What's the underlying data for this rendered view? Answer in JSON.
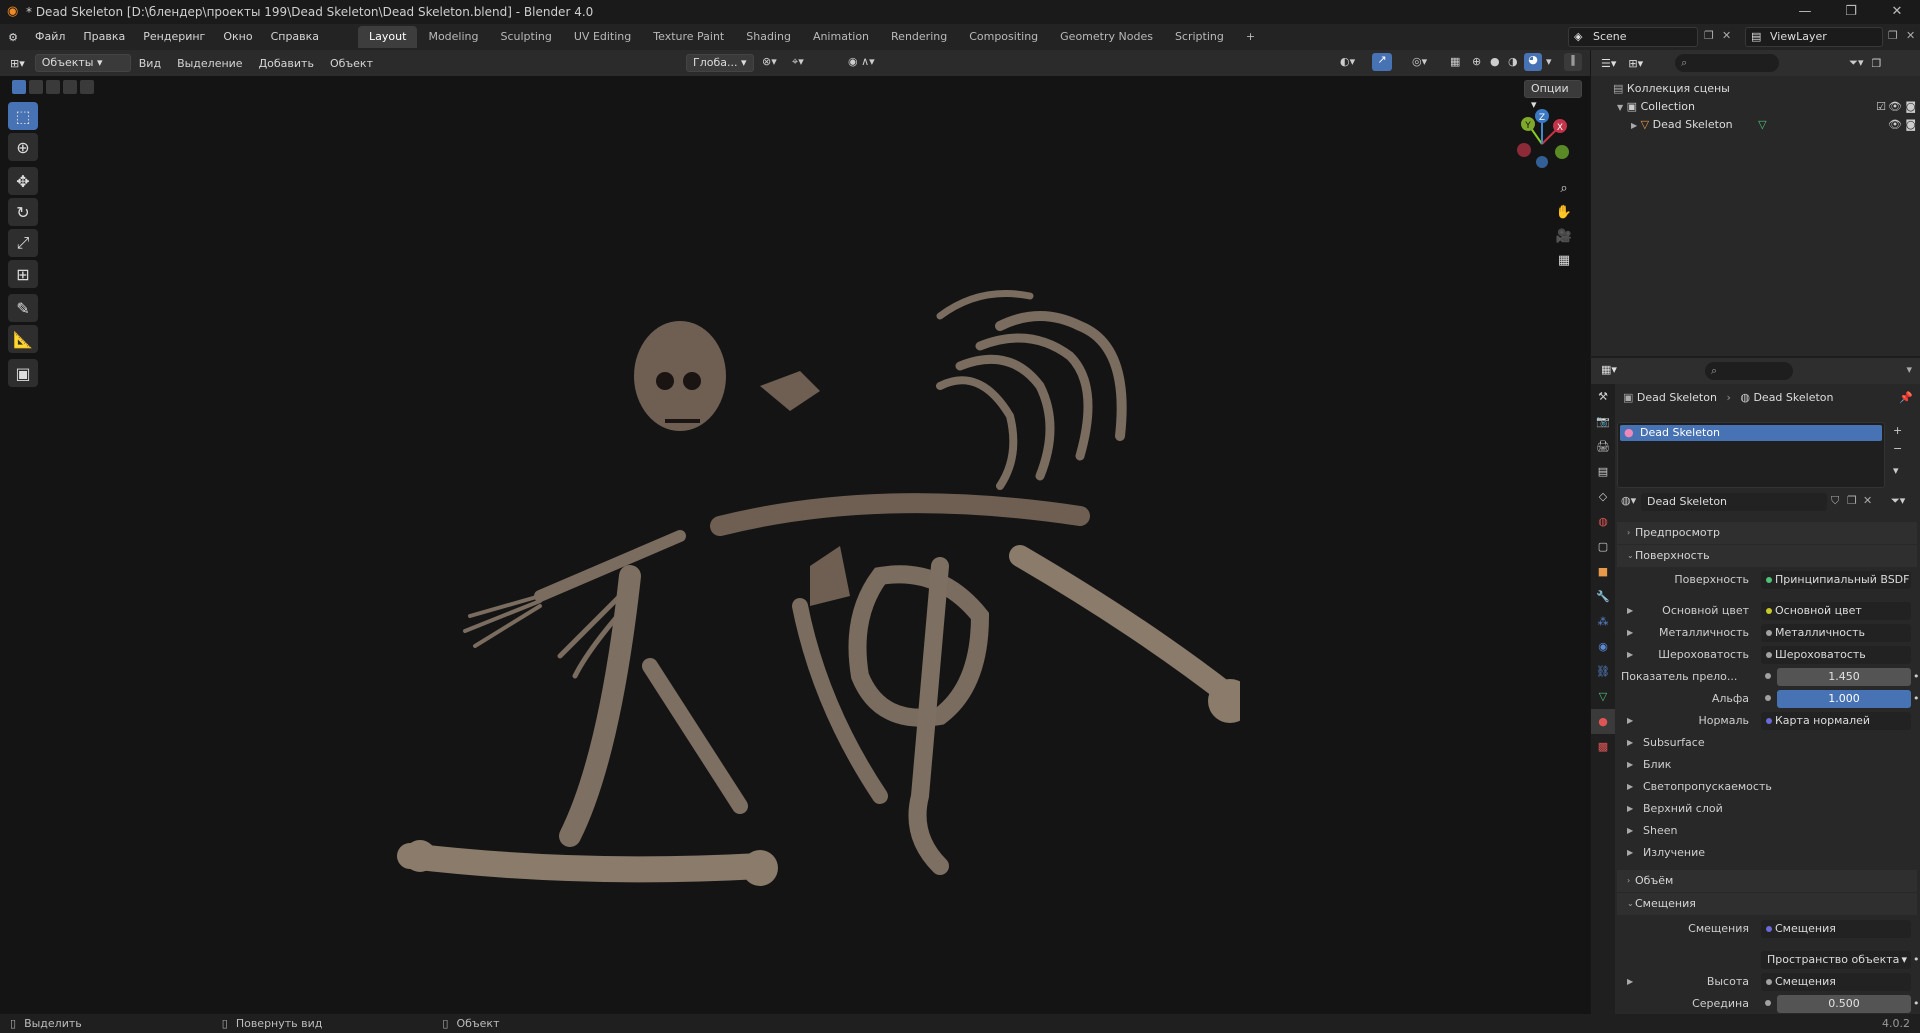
{
  "window": {
    "title": "* Dead Skeleton [D:\\блендер\\проекты 199\\Dead Skeleton\\Dead Skeleton.blend] - Blender 4.0"
  },
  "menu": [
    "Файл",
    "Правка",
    "Рендеринг",
    "Окно",
    "Справка"
  ],
  "workspaces": [
    "Layout",
    "Modeling",
    "Sculpting",
    "UV Editing",
    "Texture Paint",
    "Shading",
    "Animation",
    "Rendering",
    "Compositing",
    "Geometry Nodes",
    "Scripting"
  ],
  "active_workspace": "Layout",
  "scene": {
    "name": "Scene",
    "view_layer": "ViewLayer"
  },
  "viewport_header": {
    "mode": "Объекты",
    "items": [
      "Вид",
      "Выделение",
      "Добавить",
      "Объект"
    ],
    "transform": "Глоба...",
    "options": "Опции"
  },
  "gizmo": {
    "x": "X",
    "y": "Y",
    "z": "Z"
  },
  "outliner": {
    "root": "Коллекция сцены",
    "collection": "Collection",
    "object": "Dead Skeleton"
  },
  "properties": {
    "breadcrumb": [
      "Dead Skeleton",
      "Dead Skeleton"
    ],
    "material_slot": "Dead Skeleton",
    "material_name": "Dead Skeleton",
    "preview": "Предпросмотр",
    "surface_section": "Поверхность",
    "surface_label": "Поверхность",
    "surface_value": "Принципиальный BSDF",
    "rows": [
      {
        "label": "Основной цвет",
        "value": "Основной цвет",
        "dot": "#c7c729"
      },
      {
        "label": "Металличность",
        "value": "Металличность",
        "dot": "#a1a1a1"
      },
      {
        "label": "Шероховатость",
        "value": "Шероховатость",
        "dot": "#a1a1a1"
      }
    ],
    "ior": {
      "label": "Показатель прело...",
      "value": "1.450"
    },
    "alpha": {
      "label": "Альфа",
      "value": "1.000"
    },
    "normal": {
      "label": "Нормаль",
      "value": "Карта нормалей"
    },
    "subpanels": [
      "Subsurface",
      "Блик",
      "Светопропускаемость",
      "Верхний слой",
      "Sheen",
      "Излучение"
    ],
    "volume": "Объём",
    "displacement_section": "Смещения",
    "displacement": {
      "label": "Смещения",
      "value": "Смещения"
    },
    "space": "Пространство объекта",
    "height": {
      "label": "Высота",
      "value": "Смещения"
    },
    "midlevel": {
      "label": "Середина",
      "value": "0.500"
    }
  },
  "statusbar": {
    "select": "Выделить",
    "rotate": "Повернуть вид",
    "object": "Объект",
    "version": "4.0.2"
  },
  "colors": {
    "accent": "#4772b3",
    "bone": "#8a7b6b",
    "viewport_bg": "#141414"
  }
}
